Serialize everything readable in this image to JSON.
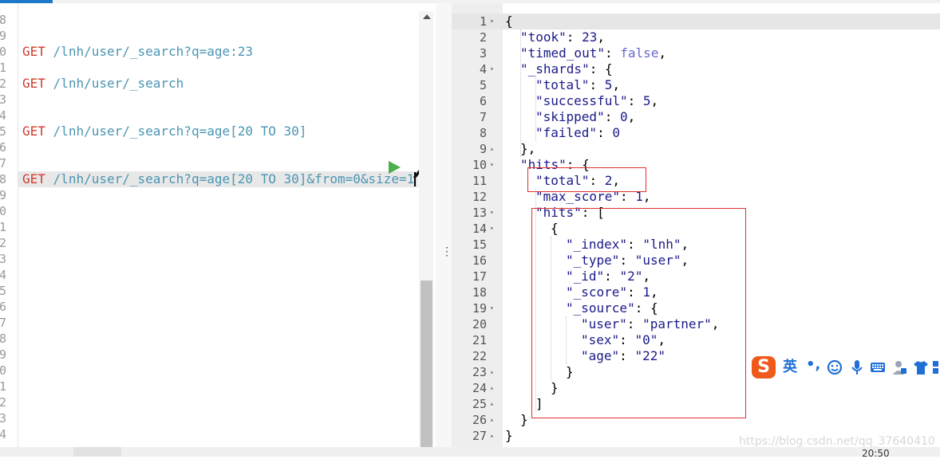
{
  "left_editor": {
    "line_numbers": [
      "8",
      "9",
      "0",
      "1",
      "2",
      "3",
      "4",
      "5",
      "6",
      "7",
      "8",
      "9",
      "0",
      "1",
      "2",
      "3",
      "4",
      "5",
      "6",
      "7",
      "8",
      "9",
      "0",
      "1",
      "2",
      "3",
      "4"
    ],
    "requests": [
      {
        "method": "GET",
        "url": "/lnh/user/_search?q=age:23"
      },
      {
        "method": "GET",
        "url": "/lnh/user/_search"
      },
      {
        "method": "GET",
        "url": "/lnh/user/_search?q=age[20 TO 30]"
      },
      {
        "method": "GET",
        "url": "/lnh/user/_search?q=age[20 TO 30]&from=0&size=1"
      }
    ],
    "actions": {
      "run_icon": "play-icon",
      "settings_icon": "wrench-icon"
    }
  },
  "divider_handle": "⋮",
  "response": {
    "line_numbers": [
      "1",
      "2",
      "3",
      "4",
      "5",
      "6",
      "7",
      "8",
      "9",
      "10",
      "11",
      "12",
      "13",
      "14",
      "15",
      "16",
      "17",
      "18",
      "19",
      "20",
      "21",
      "22",
      "23",
      "24",
      "25",
      "26",
      "27"
    ],
    "lines": [
      [
        "p",
        "{"
      ],
      [
        "k",
        "\"took\"",
        "p",
        ": ",
        "n",
        "23",
        "p",
        ","
      ],
      [
        "k",
        "\"timed_out\"",
        "p",
        ": ",
        "b",
        "false",
        "p",
        ","
      ],
      [
        "k",
        "\"_shards\"",
        "p",
        ": {"
      ],
      [
        "k",
        "\"total\"",
        "p",
        ": ",
        "n",
        "5",
        "p",
        ","
      ],
      [
        "k",
        "\"successful\"",
        "p",
        ": ",
        "n",
        "5",
        "p",
        ","
      ],
      [
        "k",
        "\"skipped\"",
        "p",
        ": ",
        "n",
        "0",
        "p",
        ","
      ],
      [
        "k",
        "\"failed\"",
        "p",
        ": ",
        "n",
        "0"
      ],
      [
        "p",
        "},"
      ],
      [
        "k",
        "\"hits\"",
        "p",
        ": {"
      ],
      [
        "k",
        "\"total\"",
        "p",
        ": ",
        "n",
        "2",
        "p",
        ","
      ],
      [
        "k",
        "\"max_score\"",
        "p",
        ": ",
        "n",
        "1",
        "p",
        ","
      ],
      [
        "k",
        "\"hits\"",
        "p",
        ": ["
      ],
      [
        "p",
        "{"
      ],
      [
        "k",
        "\"_index\"",
        "p",
        ": ",
        "s",
        "\"lnh\"",
        "p",
        ","
      ],
      [
        "k",
        "\"_type\"",
        "p",
        ": ",
        "s",
        "\"user\"",
        "p",
        ","
      ],
      [
        "k",
        "\"_id\"",
        "p",
        ": ",
        "s",
        "\"2\"",
        "p",
        ","
      ],
      [
        "k",
        "\"_score\"",
        "p",
        ": ",
        "n",
        "1",
        "p",
        ","
      ],
      [
        "k",
        "\"_source\"",
        "p",
        ": {"
      ],
      [
        "k",
        "\"user\"",
        "p",
        ": ",
        "s",
        "\"partner\"",
        "p",
        ","
      ],
      [
        "k",
        "\"sex\"",
        "p",
        ": ",
        "s",
        "\"0\"",
        "p",
        ","
      ],
      [
        "k",
        "\"age\"",
        "p",
        ": ",
        "s",
        "\"22\""
      ],
      [
        "p",
        "}"
      ],
      [
        "p",
        "}"
      ],
      [
        "p",
        "]"
      ],
      [
        "p",
        "}"
      ],
      [
        "p",
        "}"
      ]
    ],
    "indent_levels": [
      0,
      1,
      1,
      1,
      2,
      2,
      2,
      2,
      1,
      1,
      2,
      2,
      2,
      3,
      4,
      4,
      4,
      4,
      4,
      5,
      5,
      5,
      4,
      3,
      2,
      1,
      0
    ],
    "fold_markers": {
      "1": "▾",
      "4": "▾",
      "9": "▴",
      "10": "▾",
      "13": "▾",
      "14": "▾",
      "19": "▾",
      "23": "▴",
      "24": "▴",
      "25": "▴",
      "26": "▴",
      "27": "▴"
    }
  },
  "ime_toolbar": {
    "logo": "S",
    "mode": "英",
    "punct": "•,",
    "icons": [
      "emoji-icon",
      "microphone-icon",
      "keyboard-icon",
      "user-icon",
      "shirt-icon"
    ]
  },
  "watermark": "https://blog.csdn.net/qq_37640410",
  "taskbar_clock": "20:50",
  "colors": {
    "method": "#d03b2e",
    "url": "#4a96b4",
    "highlight_box": "#e03030",
    "run_button": "#4cae4c",
    "ime_logo": "#ef5a1c",
    "ime_text": "#1f6fd6"
  }
}
